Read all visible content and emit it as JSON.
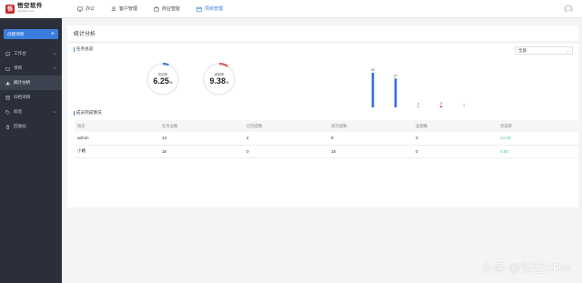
{
  "app": {
    "logo_title": "悟空软件",
    "logo_url": "www.5kcrm.com"
  },
  "topnav": [
    {
      "label": "办公",
      "icon": "monitor-icon"
    },
    {
      "label": "客户管理",
      "icon": "user-icon"
    },
    {
      "label": "商业智能",
      "icon": "briefcase-icon"
    },
    {
      "label": "项目管理",
      "icon": "calendar-icon",
      "active": true
    }
  ],
  "sidebar": {
    "create_label": "创建项目",
    "create_plus": "+",
    "items": [
      {
        "label": "工作台",
        "icon": "monitor-icon",
        "chevron": true
      },
      {
        "label": "项目",
        "icon": "folder-icon",
        "chevron": true
      },
      {
        "label": "统计分析",
        "icon": "bar-chart-icon",
        "active": true
      },
      {
        "label": "归档项目",
        "icon": "archive-icon"
      },
      {
        "label": "标签",
        "icon": "tag-icon",
        "chevron": true
      },
      {
        "label": "回收站",
        "icon": "trash-icon"
      }
    ]
  },
  "page": {
    "title": "统计分析"
  },
  "overview": {
    "title": "任务总览",
    "select_value": "全部",
    "gauges": [
      {
        "label": "完成率",
        "value": "6.25",
        "unit": "%",
        "fraction": 0.0625,
        "color": "#3b7ddd"
      },
      {
        "label": "逾期率",
        "value": "9.38",
        "unit": "%",
        "fraction": 0.0938,
        "color": "#e05b5b"
      }
    ],
    "chart_data": {
      "type": "bar",
      "categories": [
        "总任务",
        "未完成",
        "已完成",
        "已逾期",
        "已归档"
      ],
      "values": [
        32,
        27,
        2,
        3,
        1
      ],
      "colors": [
        "#2f6fd6",
        "#2f6fd6",
        "#2f6fd6",
        "#e05b5b",
        "#2f6fd6"
      ],
      "ylim": [
        0,
        32
      ],
      "title": "",
      "xlabel": "",
      "ylabel": ""
    }
  },
  "members": {
    "title": "成员完成情况",
    "columns": [
      "姓名",
      "任务总数",
      "已完成数",
      "未完成数",
      "逾期数",
      "完成率"
    ],
    "rows": [
      [
        "admin",
        "14",
        "2",
        "9",
        "3",
        "14.29"
      ],
      [
        "小路",
        "18",
        "0",
        "18",
        "0",
        "0.00"
      ]
    ]
  },
  "watermark": "头条 @悟空CRM"
}
